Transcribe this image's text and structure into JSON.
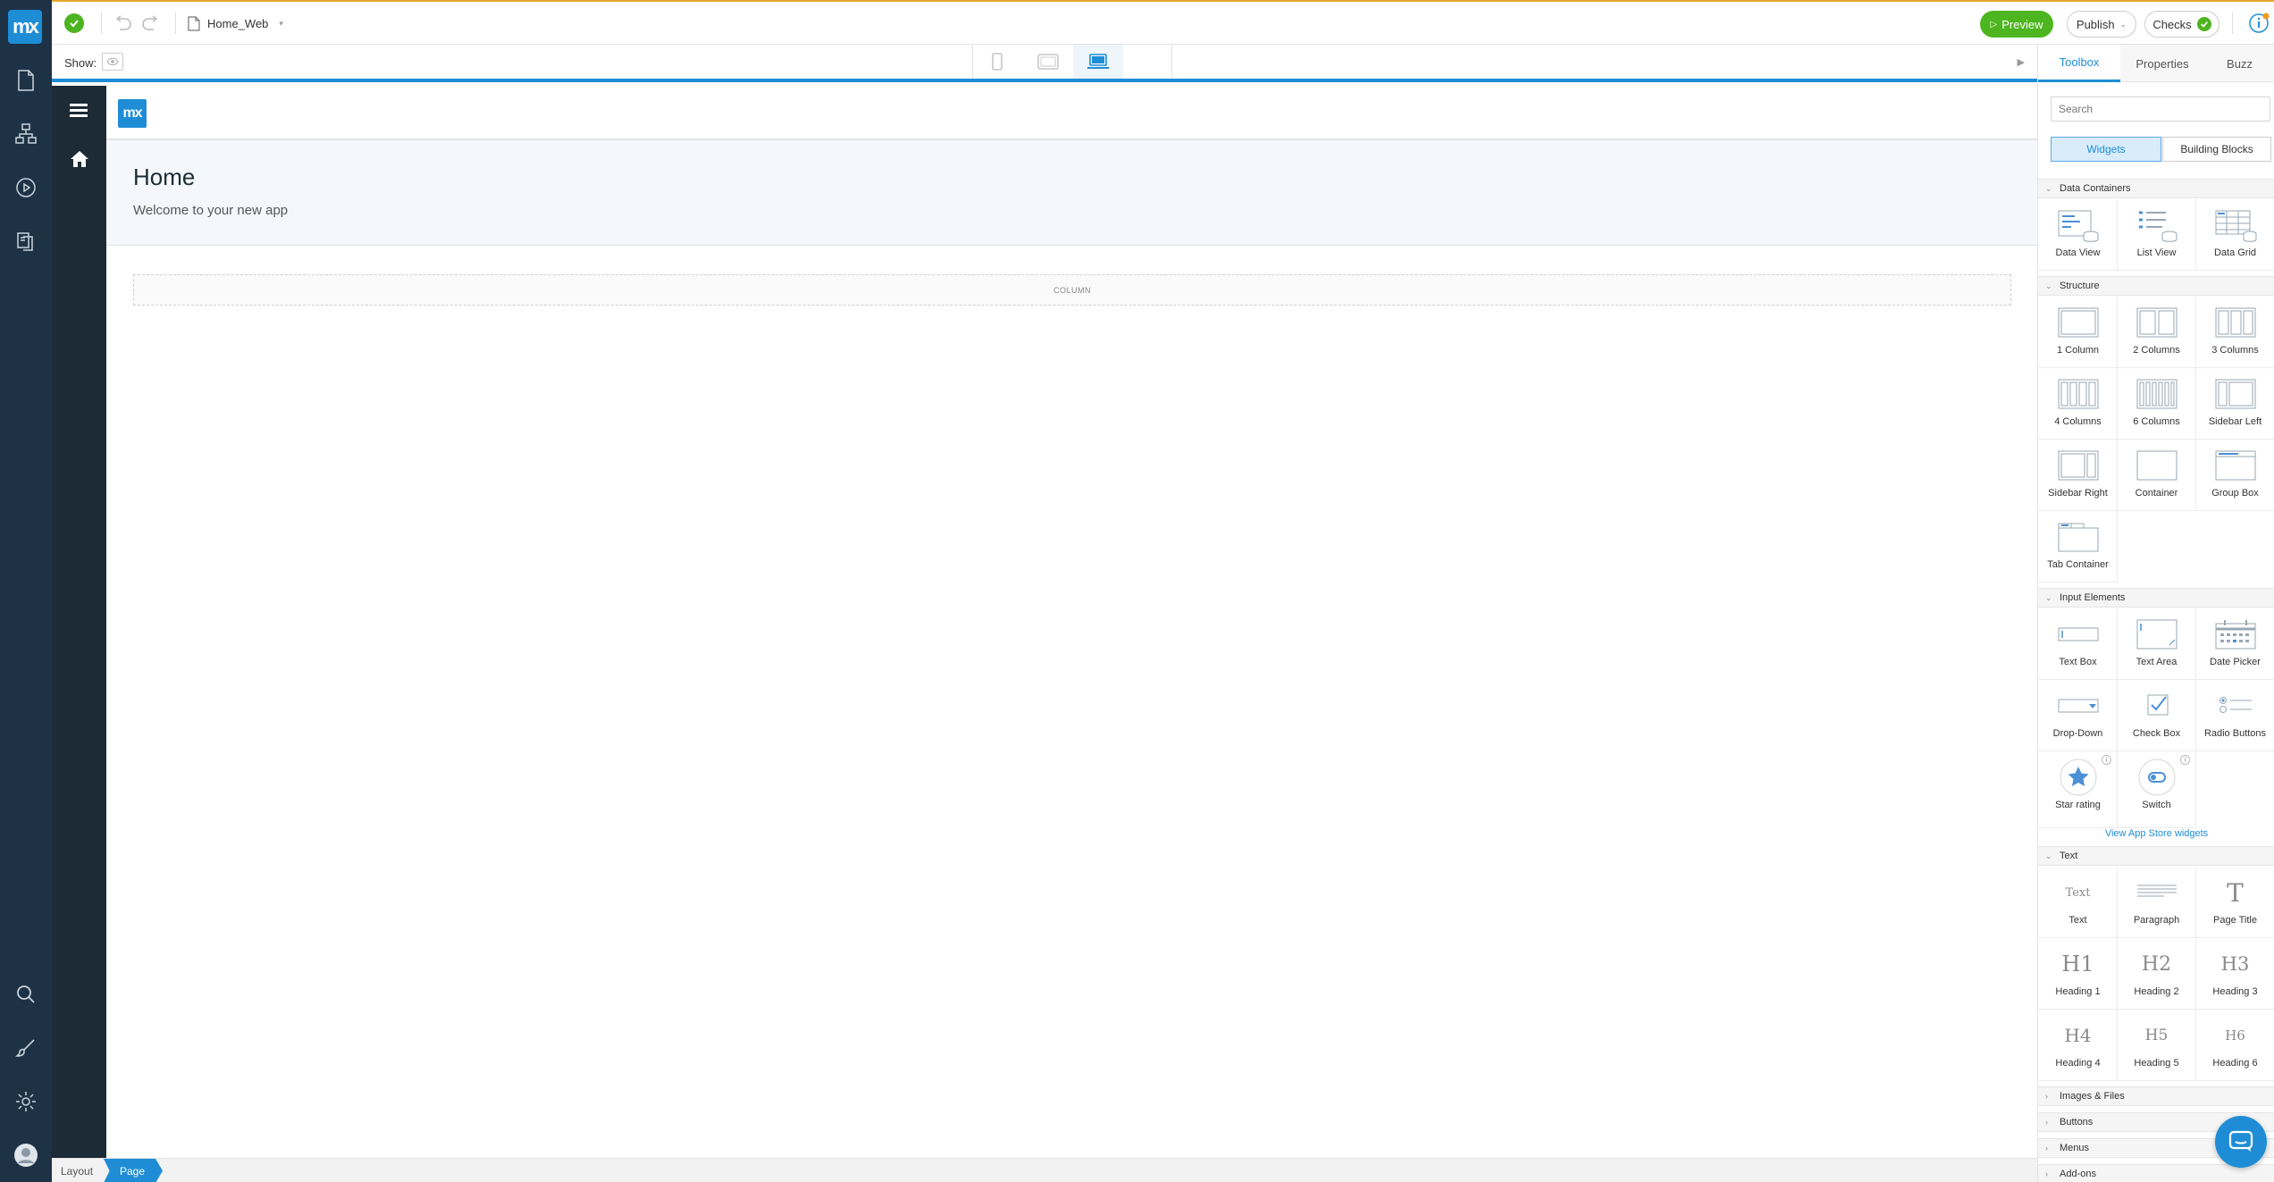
{
  "rail": {
    "logo": "mx",
    "icons": [
      "page-icon",
      "domain-model-icon",
      "run-icon",
      "documents-icon",
      "search-icon",
      "theme-brush-icon",
      "settings-icon",
      "user-avatar-icon"
    ]
  },
  "topbar": {
    "document_title": "Home_Web",
    "preview_label": "Preview",
    "publish_label": "Publish",
    "checks_label": "Checks"
  },
  "showbar": {
    "show_label": "Show:"
  },
  "canvas": {
    "page_title": "Home",
    "page_subtitle": "Welcome to your new app",
    "header_logo": "mx",
    "column_label": "COLUMN"
  },
  "breadcrumb": {
    "layout": "Layout",
    "page": "Page"
  },
  "panel": {
    "tabs": [
      "Toolbox",
      "Properties",
      "Buzz"
    ],
    "search_placeholder": "Search",
    "segments": [
      "Widgets",
      "Building Blocks"
    ],
    "sections": {
      "data_containers": "Data Containers",
      "structure": "Structure",
      "input_elements": "Input Elements",
      "text": "Text",
      "images_files": "Images & Files",
      "buttons": "Buttons",
      "menus": "Menus",
      "addons": "Add-ons"
    },
    "data_containers": [
      "Data View",
      "List View",
      "Data Grid"
    ],
    "structure": [
      "1 Column",
      "2 Columns",
      "3 Columns",
      "4 Columns",
      "6 Columns",
      "Sidebar Left",
      "Sidebar Right",
      "Container",
      "Group Box",
      "Tab Container"
    ],
    "input_elements": [
      "Text Box",
      "Text Area",
      "Date Picker",
      "Drop-Down",
      "Check Box",
      "Radio Buttons",
      "Star rating",
      "Switch"
    ],
    "store_link": "View App Store widgets",
    "text_widgets": [
      "Text",
      "Paragraph",
      "Page Title",
      "Heading 1",
      "Heading 2",
      "Heading 3",
      "Heading 4",
      "Heading 5",
      "Heading 6"
    ],
    "text_glyphs": [
      "Text",
      "T",
      "H1",
      "H2",
      "H3",
      "H4",
      "H5",
      "H6"
    ]
  },
  "colors": {
    "accent": "#1f8dd6",
    "success": "#4db51f",
    "rail": "#1e3246",
    "app_sidebar": "#1c2b36",
    "topbar_line": "#e6a72e"
  }
}
